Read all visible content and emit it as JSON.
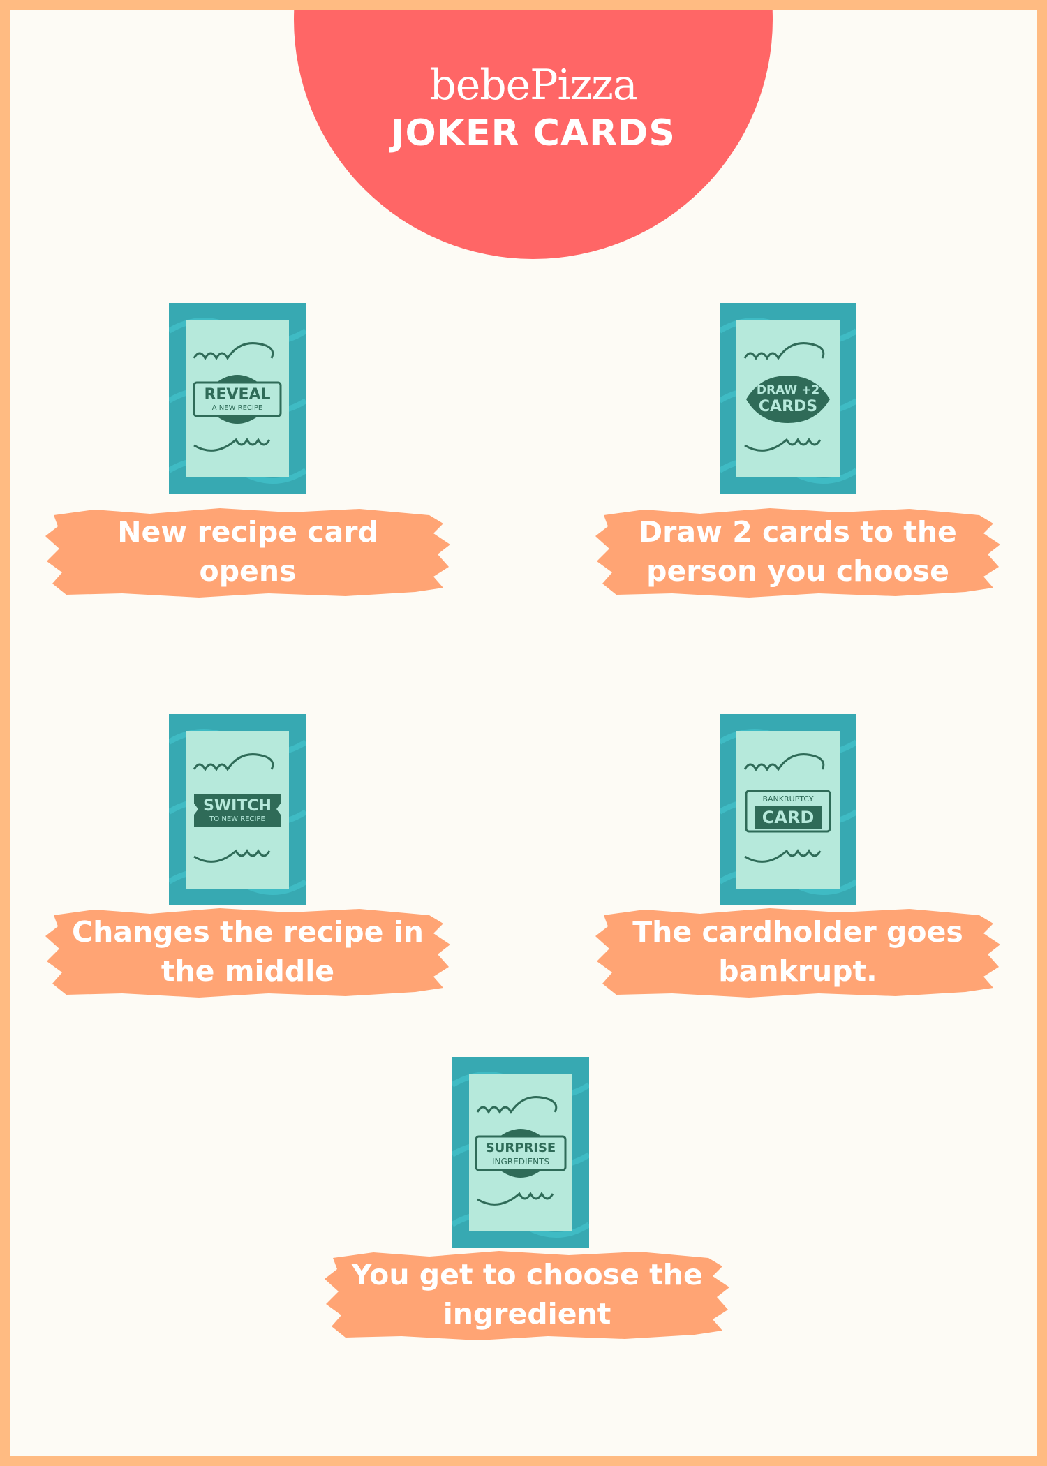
{
  "header": {
    "brand": "bebePizza",
    "title": "JOKER CARDS"
  },
  "colors": {
    "background": "#fdfbf5",
    "border": "#ffbb82",
    "header_circle": "#ff6666",
    "card_frame": "#37a9b2",
    "card_face": "#b6e9db",
    "card_ink": "#2f6b58",
    "brush": "#ffa474"
  },
  "cards": [
    {
      "line1": "REVEAL",
      "line2": "A NEW RECIPE",
      "description": "New recipe card opens"
    },
    {
      "line1": "DRAW +2",
      "line2": "CARDS",
      "description": "Draw 2 cards to the person you choose"
    },
    {
      "line1": "SWITCH",
      "line2": "TO NEW RECIPE",
      "description": "Changes the recipe in the middle"
    },
    {
      "line1": "BANKRUPTCY",
      "line2": "CARD",
      "description": "The cardholder goes bankrupt."
    },
    {
      "line1": "SURPRISE",
      "line2": "INGREDIENTS",
      "description": "You get to choose the ingredient"
    }
  ]
}
